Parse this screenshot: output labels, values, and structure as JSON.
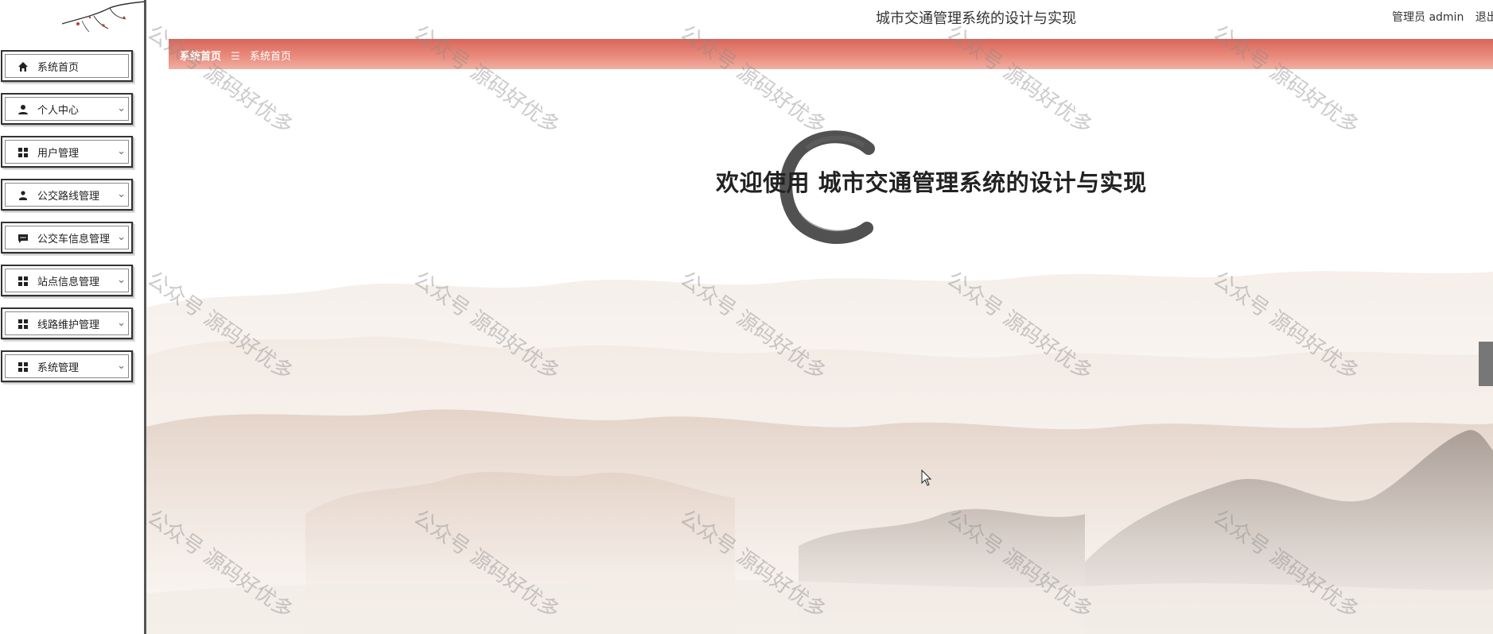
{
  "app": {
    "title": "城市交通管理系统的设计与实现"
  },
  "header": {
    "user_role": "管理员 admin",
    "logout_label": "退出登录"
  },
  "breadcrumb": {
    "home": "系统首页",
    "separator": "☰",
    "current": "系统首页"
  },
  "sidebar": {
    "items": [
      {
        "label": "系统首页",
        "icon": "home-icon",
        "has_submenu": false
      },
      {
        "label": "个人中心",
        "icon": "user-icon",
        "has_submenu": true
      },
      {
        "label": "用户管理",
        "icon": "grid-icon",
        "has_submenu": true
      },
      {
        "label": "公交路线管理",
        "icon": "person-icon",
        "has_submenu": true
      },
      {
        "label": "公交车信息管理",
        "icon": "chat-icon",
        "has_submenu": true
      },
      {
        "label": "站点信息管理",
        "icon": "grid-icon",
        "has_submenu": true
      },
      {
        "label": "线路维护管理",
        "icon": "grid-icon",
        "has_submenu": true
      },
      {
        "label": "系统管理",
        "icon": "grid-icon",
        "has_submenu": true
      }
    ]
  },
  "main": {
    "welcome": "欢迎使用 城市交通管理系统的设计与实现"
  },
  "watermark": {
    "text": "公众号 源码好优多"
  },
  "colors": {
    "breadcrumb_bar": "#e07a6c",
    "sidebar_border": "#333333",
    "scrollbar_thumb": "#777777"
  }
}
